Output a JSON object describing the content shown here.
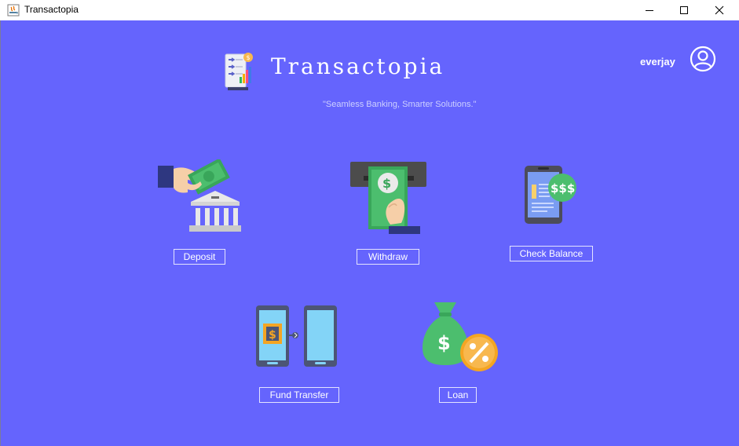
{
  "window": {
    "title": "Transactopia",
    "controls": {
      "minimize": "minimize",
      "maximize": "maximize",
      "close": "close"
    }
  },
  "header": {
    "brand": "Transactopia",
    "tagline": "\"Seamless Banking, Smarter Solutions.\"",
    "username": "everjay",
    "logo_icon": "ledger-chart-icon",
    "avatar_icon": "user-avatar-icon"
  },
  "services": [
    {
      "label": "Deposit",
      "icon": "deposit-icon"
    },
    {
      "label": "Withdraw",
      "icon": "withdraw-icon"
    },
    {
      "label": "Check Balance",
      "icon": "check-balance-icon"
    },
    {
      "label": "Fund Transfer",
      "icon": "fund-transfer-icon"
    },
    {
      "label": "Loan",
      "icon": "loan-icon"
    }
  ],
  "colors": {
    "background": "#6564fd",
    "text": "#ffffff",
    "money_green": "#4cbe6e",
    "button_border": "#e4e4ff"
  }
}
